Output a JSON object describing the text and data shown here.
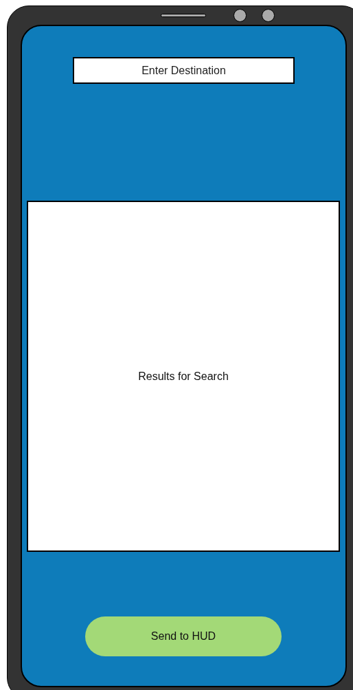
{
  "search": {
    "placeholder": "Enter Destination"
  },
  "results": {
    "text": "Results for Search"
  },
  "send_button": {
    "label": "Send to HUD"
  }
}
